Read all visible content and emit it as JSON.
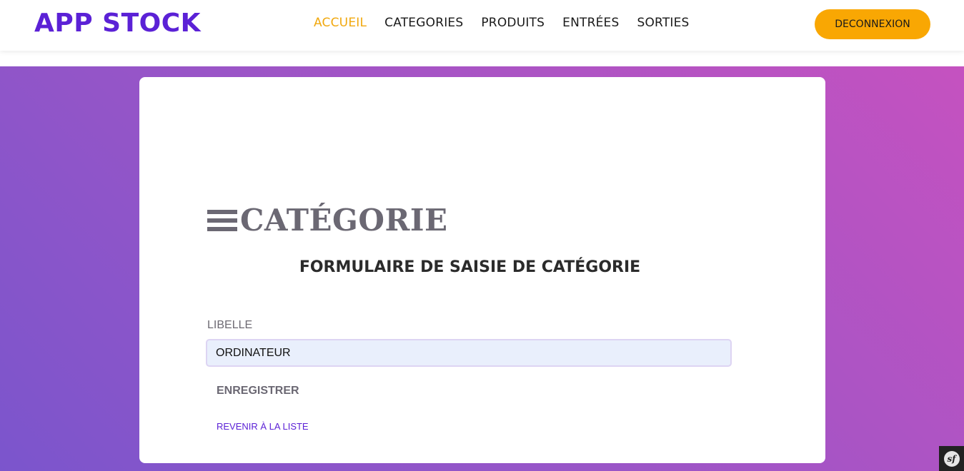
{
  "header": {
    "logo": "APP STOCK",
    "nav": [
      {
        "label": "ACCUEIL",
        "active": true
      },
      {
        "label": "CATEGORIES",
        "active": false
      },
      {
        "label": "PRODUITS",
        "active": false
      },
      {
        "label": "ENTRÉES",
        "active": false
      },
      {
        "label": "SORTIES",
        "active": false
      }
    ],
    "logout_label": "DECONNEXION"
  },
  "form": {
    "heading": "CATÉGORIE",
    "heading_icon": "menu-icon",
    "subtitle": "FORMULAIRE DE SAISIE DE CATÉGORIE",
    "libelle_label": "LIBELLE",
    "libelle_value": "ORDINATEUR",
    "save_label": "ENREGISTRER",
    "back_label": "REVENIR À LA LISTE"
  },
  "toolbar_badge": {
    "icon": "symfony-icon",
    "text": "sf"
  },
  "colors": {
    "brand": "#5b21d6",
    "accent": "#f9a703",
    "active_nav": "#f1a80e",
    "gradient_start": "#7b55cc",
    "gradient_end": "#c552c0"
  }
}
